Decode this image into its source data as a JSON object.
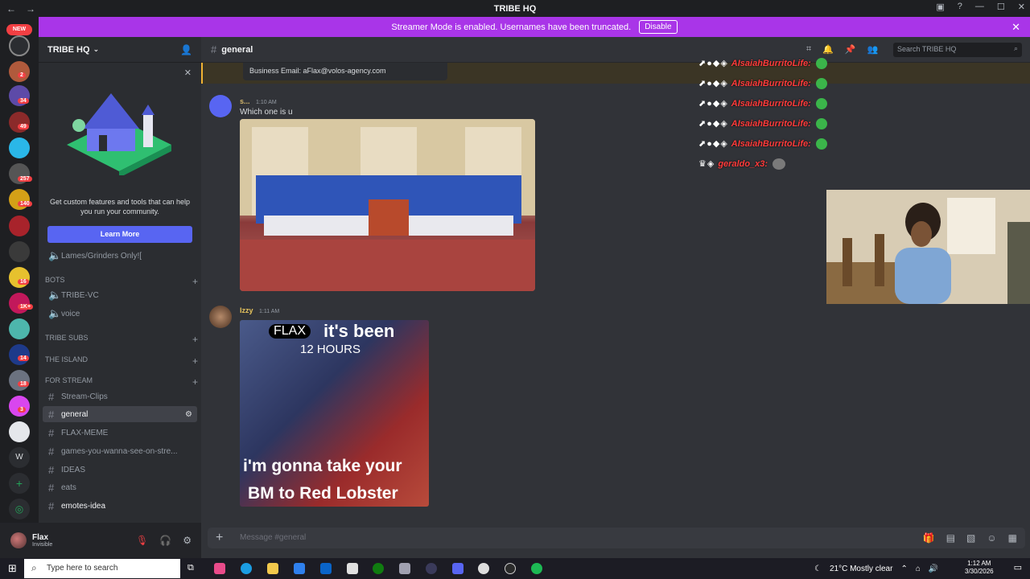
{
  "window": {
    "title": "TRIBE HQ",
    "back": "←",
    "forward": "→"
  },
  "banner": {
    "text": "Streamer Mode is enabled. Usernames have been truncated.",
    "action": "Disable"
  },
  "guilds": {
    "new_label": "NEW",
    "badges": [
      "2",
      "34",
      "49",
      "257",
      "140",
      "16",
      "1K+",
      "14",
      "18",
      "3"
    ],
    "letter": "W"
  },
  "server": {
    "name": "TRIBE HQ"
  },
  "promo": {
    "text": "Get custom features and tools that can help you run your community.",
    "button": "Learn More"
  },
  "channels": [
    {
      "name": "Lames/Grinders Only![",
      "type": "voice"
    },
    {
      "name": "BOTS",
      "type": "category"
    },
    {
      "name": "TRIBE-VC",
      "type": "voice"
    },
    {
      "name": "voice",
      "type": "voice"
    },
    {
      "name": "TRIBE SUBS",
      "type": "category"
    },
    {
      "name": "THE ISLAND",
      "type": "category"
    },
    {
      "name": "FOR STREAM",
      "type": "category"
    },
    {
      "name": "Stream-Clips",
      "type": "text"
    },
    {
      "name": "general",
      "type": "text",
      "active": true
    },
    {
      "name": "FLAX-MEME",
      "type": "text"
    },
    {
      "name": "games-you-wanna-see-on-stre...",
      "type": "text"
    },
    {
      "name": "IDEAS",
      "type": "text"
    },
    {
      "name": "eats",
      "type": "text"
    },
    {
      "name": "emotes-idea",
      "type": "text",
      "unread": true
    }
  ],
  "user": {
    "name": "Flax",
    "status": "Invisible"
  },
  "channel_header": {
    "name": "general",
    "search_placeholder": "Search TRIBE HQ"
  },
  "messages": {
    "pinned_email": "Business Email: aFlax@volos-agency.com",
    "m1": {
      "author": "s...",
      "time": "1:10 AM",
      "text": "Which one is u"
    },
    "m2": {
      "author": "Izzy",
      "time": "1:11 AM"
    }
  },
  "meme": {
    "cap_flax": "FLAX",
    "cap_been": "it's been",
    "cap_hours": "12 HOURS",
    "cap_line1": "i'm gonna take your",
    "cap_line2": "BM to Red Lobster"
  },
  "overlay_chat": [
    {
      "user": "AIsaiahBurritoLife:"
    },
    {
      "user": "AIsaiahBurritoLife:"
    },
    {
      "user": "AIsaiahBurritoLife:"
    },
    {
      "user": "AIsaiahBurritoLife:"
    },
    {
      "user": "AIsaiahBurritoLife:"
    },
    {
      "user": "geraldo_x3:"
    }
  ],
  "composer": {
    "placeholder": "Message #general"
  },
  "taskbar": {
    "search_placeholder": "Type here to search",
    "weather": "21°C  Mostly clear",
    "time": "1:12 AM",
    "date": "3/30/2026"
  },
  "colors": {
    "accent": "#5865f2",
    "banner": "#a935e8",
    "mention_red": "#f23f43"
  }
}
